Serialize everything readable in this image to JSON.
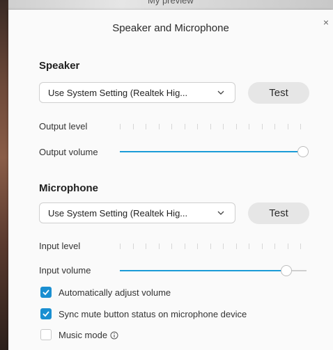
{
  "backdrop": {
    "title_fragment": "My preview"
  },
  "dialog": {
    "title": "Speaker and Microphone",
    "close_glyph": "×"
  },
  "speaker": {
    "heading": "Speaker",
    "device": "Use System Setting (Realtek Hig...",
    "test_label": "Test",
    "level_label": "Output level",
    "volume_label": "Output volume",
    "volume_fraction": 0.98
  },
  "microphone": {
    "heading": "Microphone",
    "device": "Use System Setting (Realtek Hig...",
    "test_label": "Test",
    "level_label": "Input level",
    "volume_label": "Input volume",
    "volume_fraction": 0.89
  },
  "options": [
    {
      "label": "Automatically adjust volume",
      "checked": true
    },
    {
      "label": "Sync mute button status on microphone device",
      "checked": true
    },
    {
      "label": "Music mode",
      "checked": false,
      "icon": "info-icon"
    }
  ],
  "colors": {
    "accent": "#1a9bd7",
    "checkbox": "#1a8fd1",
    "button_bg": "#e6e6e6"
  }
}
